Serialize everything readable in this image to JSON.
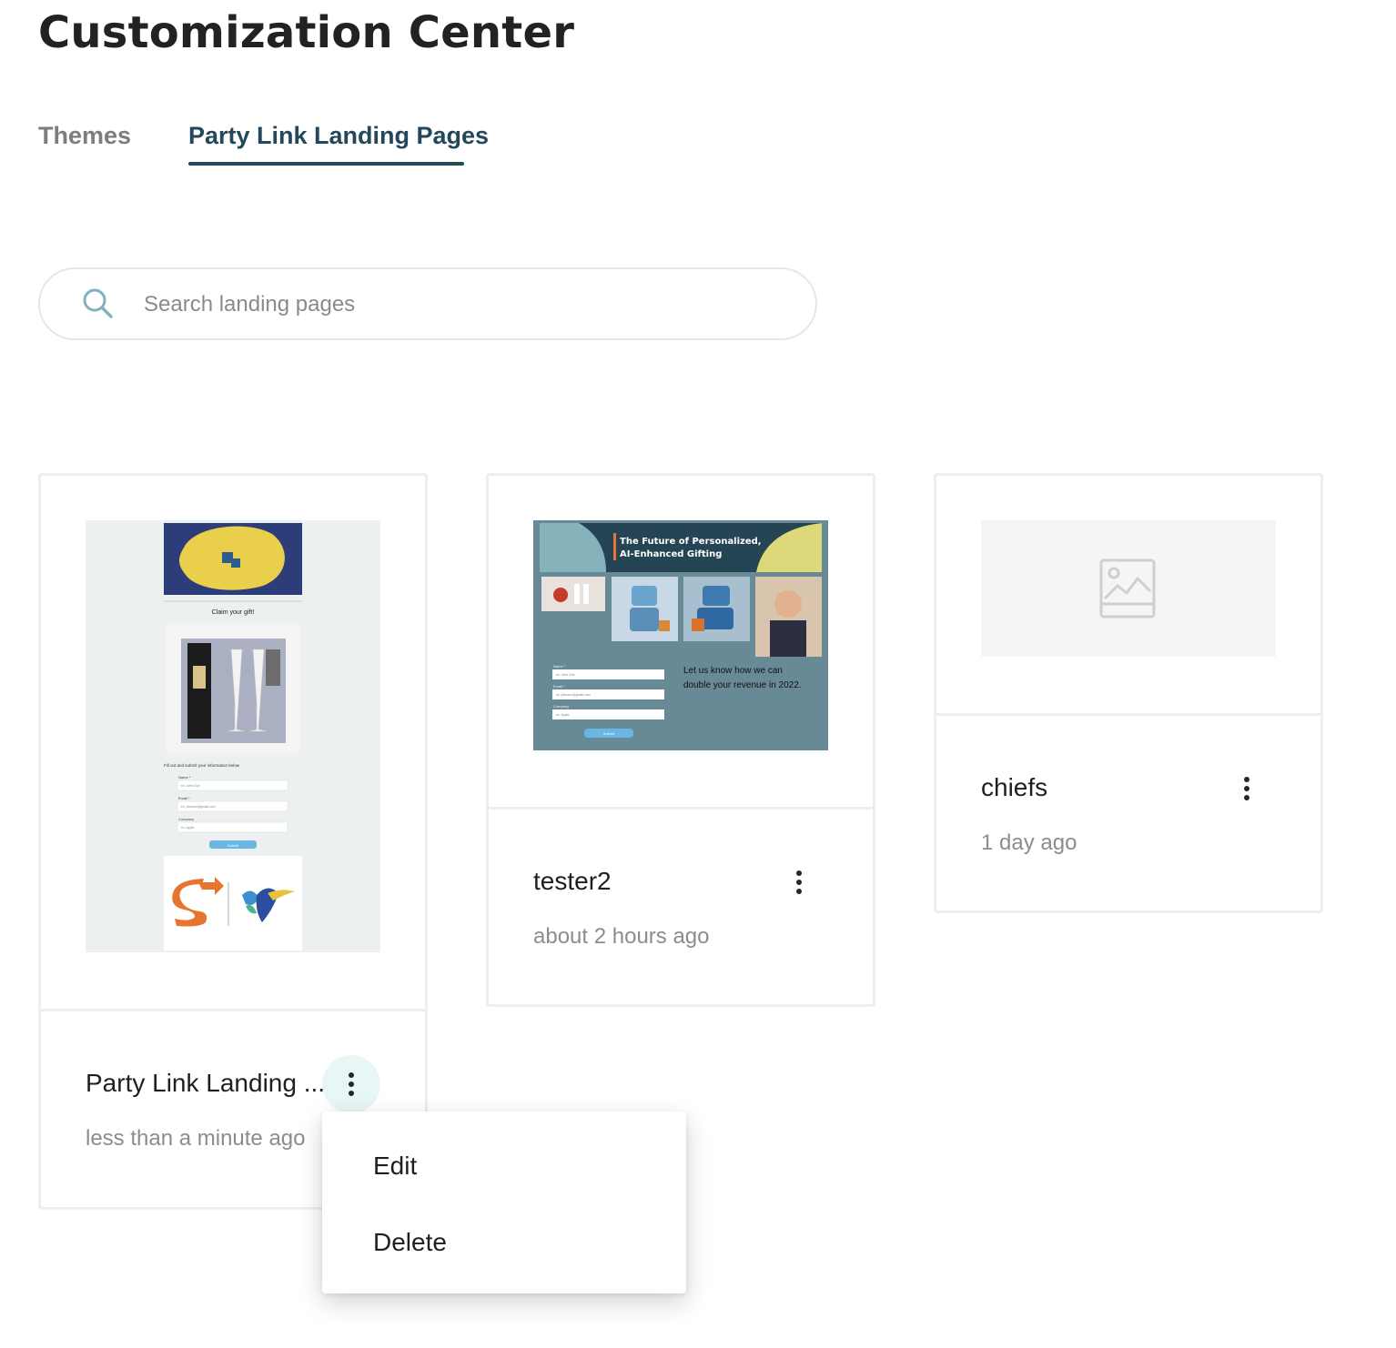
{
  "page": {
    "title": "Customization Center"
  },
  "tabs": [
    {
      "label": "Themes",
      "active": false
    },
    {
      "label": "Party Link Landing Pages",
      "active": true
    }
  ],
  "search": {
    "placeholder": "Search landing pages",
    "value": "",
    "icon": "search-icon"
  },
  "cards": [
    {
      "name": "Party Link Landing ...",
      "time": "less than a minute ago",
      "thumbnail": {
        "heading": "Claim your gift!",
        "form_title": "Fill out and submit your information below",
        "fields": [
          {
            "label": "Name *",
            "placeholder": "ex. John Doe"
          },
          {
            "label": "Email *",
            "placeholder": "ex. johndoe@gmail.com"
          },
          {
            "label": "Company",
            "placeholder": "ex. Apple"
          }
        ],
        "submit": "Submit"
      }
    },
    {
      "name": "tester2",
      "time": "about 2 hours ago",
      "thumbnail": {
        "heading_line1": "The Future of Personalized,",
        "heading_line2": "AI-Enhanced Gifting",
        "body_line1": "Let us know how we can",
        "body_line2": "double your revenue in 2022.",
        "fields": [
          {
            "label": "Name *",
            "placeholder": "ex. John Doe"
          },
          {
            "label": "Email *",
            "placeholder": "ex. johndoe@gmail.com"
          },
          {
            "label": "Company",
            "placeholder": "ex. Apple"
          }
        ],
        "submit": "Submit"
      }
    },
    {
      "name": "chiefs",
      "time": "1 day ago",
      "thumbnail": {
        "placeholder_icon": "image-placeholder-icon"
      }
    }
  ],
  "context_menu": {
    "items": [
      {
        "label": "Edit"
      },
      {
        "label": "Delete"
      }
    ]
  },
  "colors": {
    "accent": "#24485a",
    "tab_inactive": "#7d7d7d",
    "search_icon": "#7fb3bd",
    "kebab_active_bg": "#e9f6f6"
  }
}
